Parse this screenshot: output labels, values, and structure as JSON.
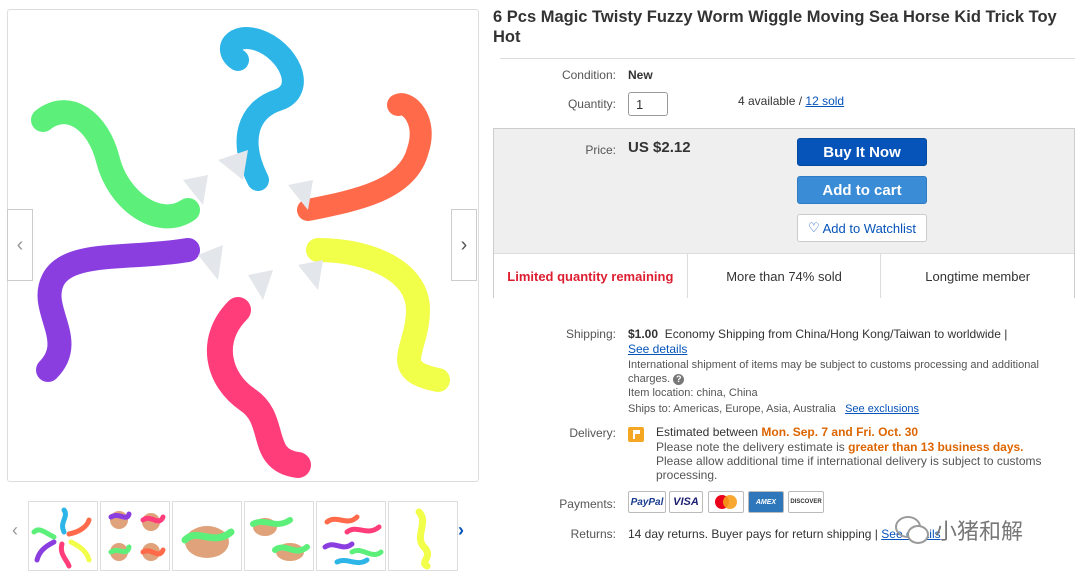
{
  "product": {
    "title": "6 Pcs Magic Twisty Fuzzy Worm Wiggle Moving Sea Horse Kid Trick Toy Hot"
  },
  "details": {
    "condition_label": "Condition:",
    "condition_value": "New",
    "quantity_label": "Quantity:",
    "quantity_value": "1",
    "available_text": "4 available /",
    "sold_link": "12 sold"
  },
  "purchase": {
    "price_label": "Price:",
    "price_value": "US $2.12",
    "buy_now": "Buy It Now",
    "add_to_cart": "Add to cart",
    "add_to_watchlist": "Add to Watchlist",
    "signals": [
      "Limited quantity remaining",
      "More than 74% sold",
      "Longtime member"
    ]
  },
  "shipping": {
    "label": "Shipping:",
    "price": "$1.00",
    "method": "Economy Shipping from China/Hong Kong/Taiwan to worldwide |",
    "see_details": "See details",
    "customs_note": "International shipment of items may be subject to customs processing and additional charges.",
    "item_location": "Item location:  china, China",
    "ships_to": "Ships to:  Americas, Europe, Asia, Australia",
    "see_exclusions": "See exclusions"
  },
  "delivery": {
    "label": "Delivery:",
    "estimated_prefix": "Estimated between",
    "dates": "Mon. Sep. 7 and Fri. Oct. 30",
    "note_prefix": "Please note the delivery estimate is",
    "note_highlight": "greater than 13 business days.",
    "additional": "Please allow additional time if international delivery is subject to customs processing."
  },
  "payments": {
    "label": "Payments:",
    "logos": [
      "PayPal",
      "VISA",
      "MasterCard",
      "AMEX",
      "DISCOVER"
    ]
  },
  "returns": {
    "label": "Returns:",
    "text": "14 day returns. Buyer pays for return shipping |",
    "link": "See details"
  },
  "watermark": {
    "text": "小猪和解"
  },
  "colors": {
    "accent_blue": "#0654ba",
    "cart_blue": "#3a8cd6",
    "alert_red": "#dd1e31",
    "delivery_orange": "#dd6500"
  }
}
